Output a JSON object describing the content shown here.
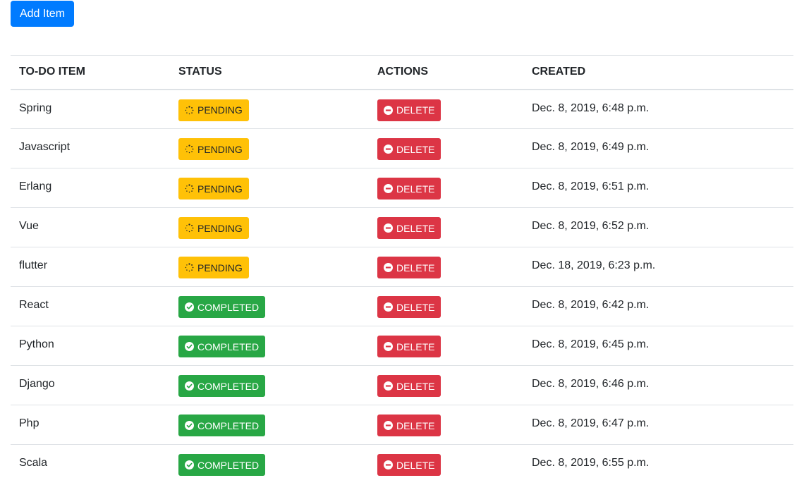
{
  "toolbar": {
    "add_label": "Add Item"
  },
  "table": {
    "headers": [
      "TO-DO ITEM",
      "STATUS",
      "ACTIONS",
      "CREATED"
    ],
    "delete_label": "DELETE",
    "rows": [
      {
        "item": "Spring",
        "status": "pending",
        "status_label": "PENDING",
        "created": "Dec. 8, 2019, 6:48 p.m."
      },
      {
        "item": "Javascript",
        "status": "pending",
        "status_label": "PENDING",
        "created": "Dec. 8, 2019, 6:49 p.m."
      },
      {
        "item": "Erlang",
        "status": "pending",
        "status_label": "PENDING",
        "created": "Dec. 8, 2019, 6:51 p.m."
      },
      {
        "item": "Vue",
        "status": "pending",
        "status_label": "PENDING",
        "created": "Dec. 8, 2019, 6:52 p.m."
      },
      {
        "item": "flutter",
        "status": "pending",
        "status_label": "PENDING",
        "created": "Dec. 18, 2019, 6:23 p.m."
      },
      {
        "item": "React",
        "status": "completed",
        "status_label": "COMPLETED",
        "created": "Dec. 8, 2019, 6:42 p.m."
      },
      {
        "item": "Python",
        "status": "completed",
        "status_label": "COMPLETED",
        "created": "Dec. 8, 2019, 6:45 p.m."
      },
      {
        "item": "Django",
        "status": "completed",
        "status_label": "COMPLETED",
        "created": "Dec. 8, 2019, 6:46 p.m."
      },
      {
        "item": "Php",
        "status": "completed",
        "status_label": "COMPLETED",
        "created": "Dec. 8, 2019, 6:47 p.m."
      },
      {
        "item": "Scala",
        "status": "completed",
        "status_label": "COMPLETED",
        "created": "Dec. 8, 2019, 6:55 p.m."
      }
    ]
  },
  "icons": {
    "pending": "spinner-icon",
    "completed": "check-circle-icon",
    "delete": "minus-circle-icon"
  },
  "colors": {
    "primary": "#007bff",
    "pending": "#ffc107",
    "completed": "#28a745",
    "danger": "#dc3545"
  }
}
